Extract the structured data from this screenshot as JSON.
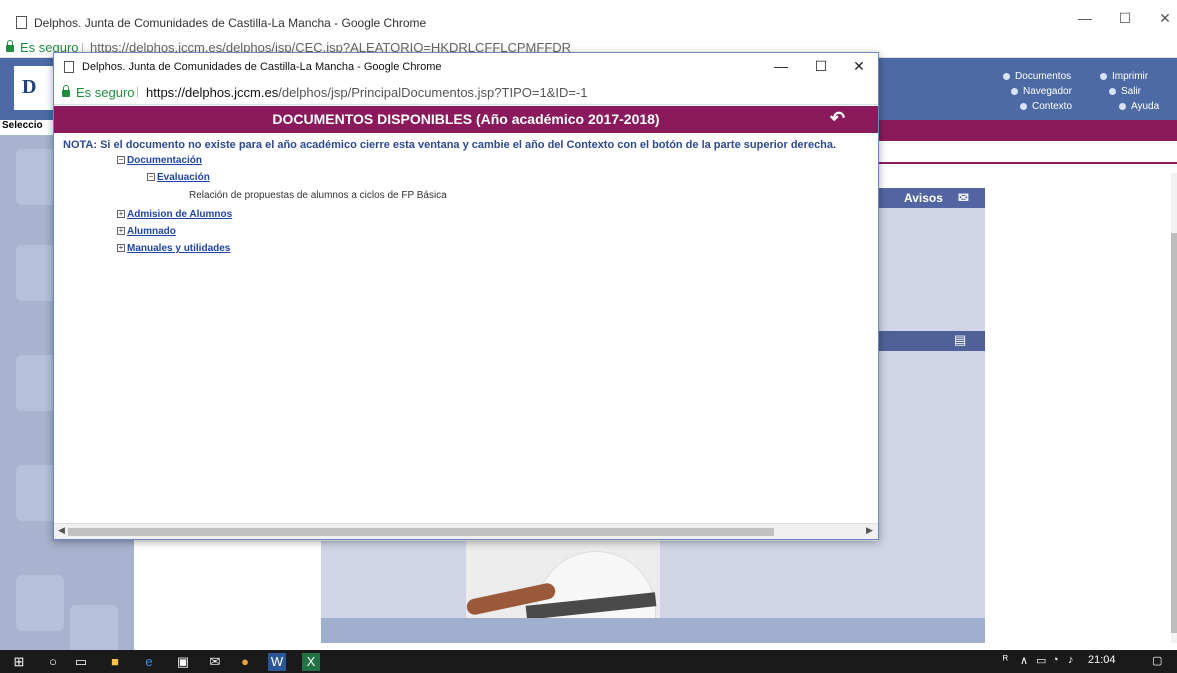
{
  "bg_window": {
    "title": "Delphos. Junta de Comunidades de Castilla-La Mancha - Google Chrome",
    "secure_label": "Es seguro",
    "url": "https://delphos.jccm.es/delphos/jsp/CEC.jsp?ALEATORIO=HKDRLCFFLCPMFFDR",
    "minimize": "—",
    "maximize": "☐",
    "close": "✕"
  },
  "bg_page": {
    "logo_letter": "D",
    "selection_label": "Seleccio",
    "nav": {
      "documentos": "Documentos",
      "imprimir": "Imprimir",
      "navegador": "Navegador",
      "salir": "Salir",
      "contexto": "Contexto",
      "ayuda": "Ayuda"
    },
    "avisos": "Avisos"
  },
  "popup": {
    "title": "Delphos. Junta de Comunidades de Castilla-La Mancha - Google Chrome",
    "secure_label": "Es seguro",
    "url_host": "https://delphos.jccm.es",
    "url_path": "/delphos/jsp/PrincipalDocumentos.jsp?TIPO=1&ID=-1",
    "minimize": "—",
    "maximize": "☐",
    "close": "✕",
    "header": "DOCUMENTOS DISPONIBLES (Año académico 2017-2018)",
    "back_icon": "↶",
    "nota": "NOTA: Si el documento no existe para el año académico cierre esta ventana y cambie el año del Contexto con el botón de la parte superior derecha.",
    "tree": {
      "documentacion": "Documentación",
      "evaluacion": "Evaluación",
      "relacion": "Relación de propuestas de alumnos a ciclos de FP Básica",
      "admision": "Admision de Alumnos",
      "alumnado": "Alumnado",
      "manuales": "Manuales y utilidades",
      "collapse_glyph": "−",
      "expand_glyph": "+"
    }
  },
  "taskbar": {
    "time": "21:04"
  },
  "colors": {
    "header_purple": "#8b1a5c",
    "link_blue": "#1f45a6",
    "secure_green": "#1e8e3e",
    "delphos_blue": "#4e6aa5"
  }
}
